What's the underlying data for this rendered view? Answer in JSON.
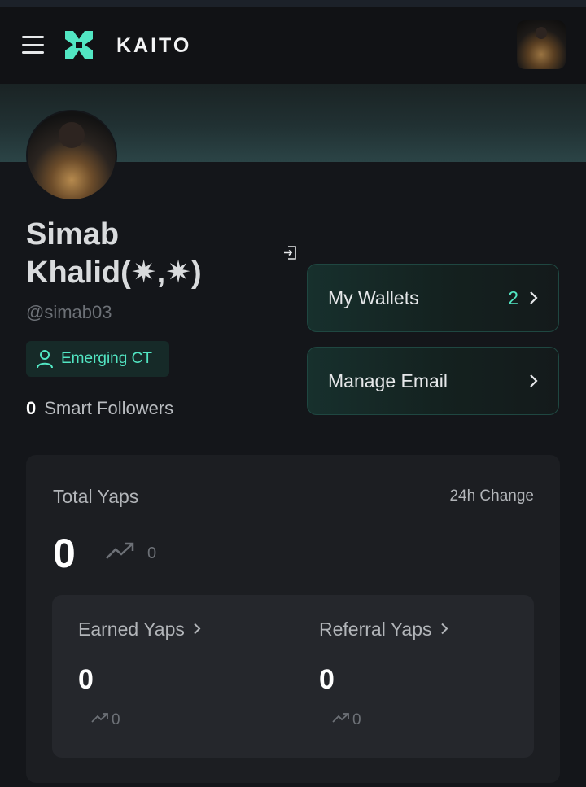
{
  "header": {
    "brand": "KAITO"
  },
  "profile": {
    "name": "Simab Khalid(✷,✷)",
    "handle": "@simab03",
    "badge": "Emerging CT",
    "smart_followers_count": "0",
    "smart_followers_label": "Smart Followers"
  },
  "actions": {
    "wallets_label": "My Wallets",
    "wallets_count": "2",
    "email_label": "Manage Email"
  },
  "yaps": {
    "title": "Total Yaps",
    "change_label": "24h Change",
    "total": "0",
    "total_change": "0",
    "earned_label": "Earned Yaps",
    "earned_value": "0",
    "earned_change": "0",
    "referral_label": "Referral Yaps",
    "referral_value": "0",
    "referral_change": "0"
  },
  "icons": {
    "menu": "hamburger-menu-icon",
    "logo": "kaito-logo-icon",
    "logout": "logout-icon",
    "badge": "user-icon",
    "chevron": "chevron-right-icon",
    "trend": "trending-up-icon"
  },
  "colors": {
    "accent": "#52e6c3",
    "background": "#14161a",
    "card": "#1c1e22"
  }
}
